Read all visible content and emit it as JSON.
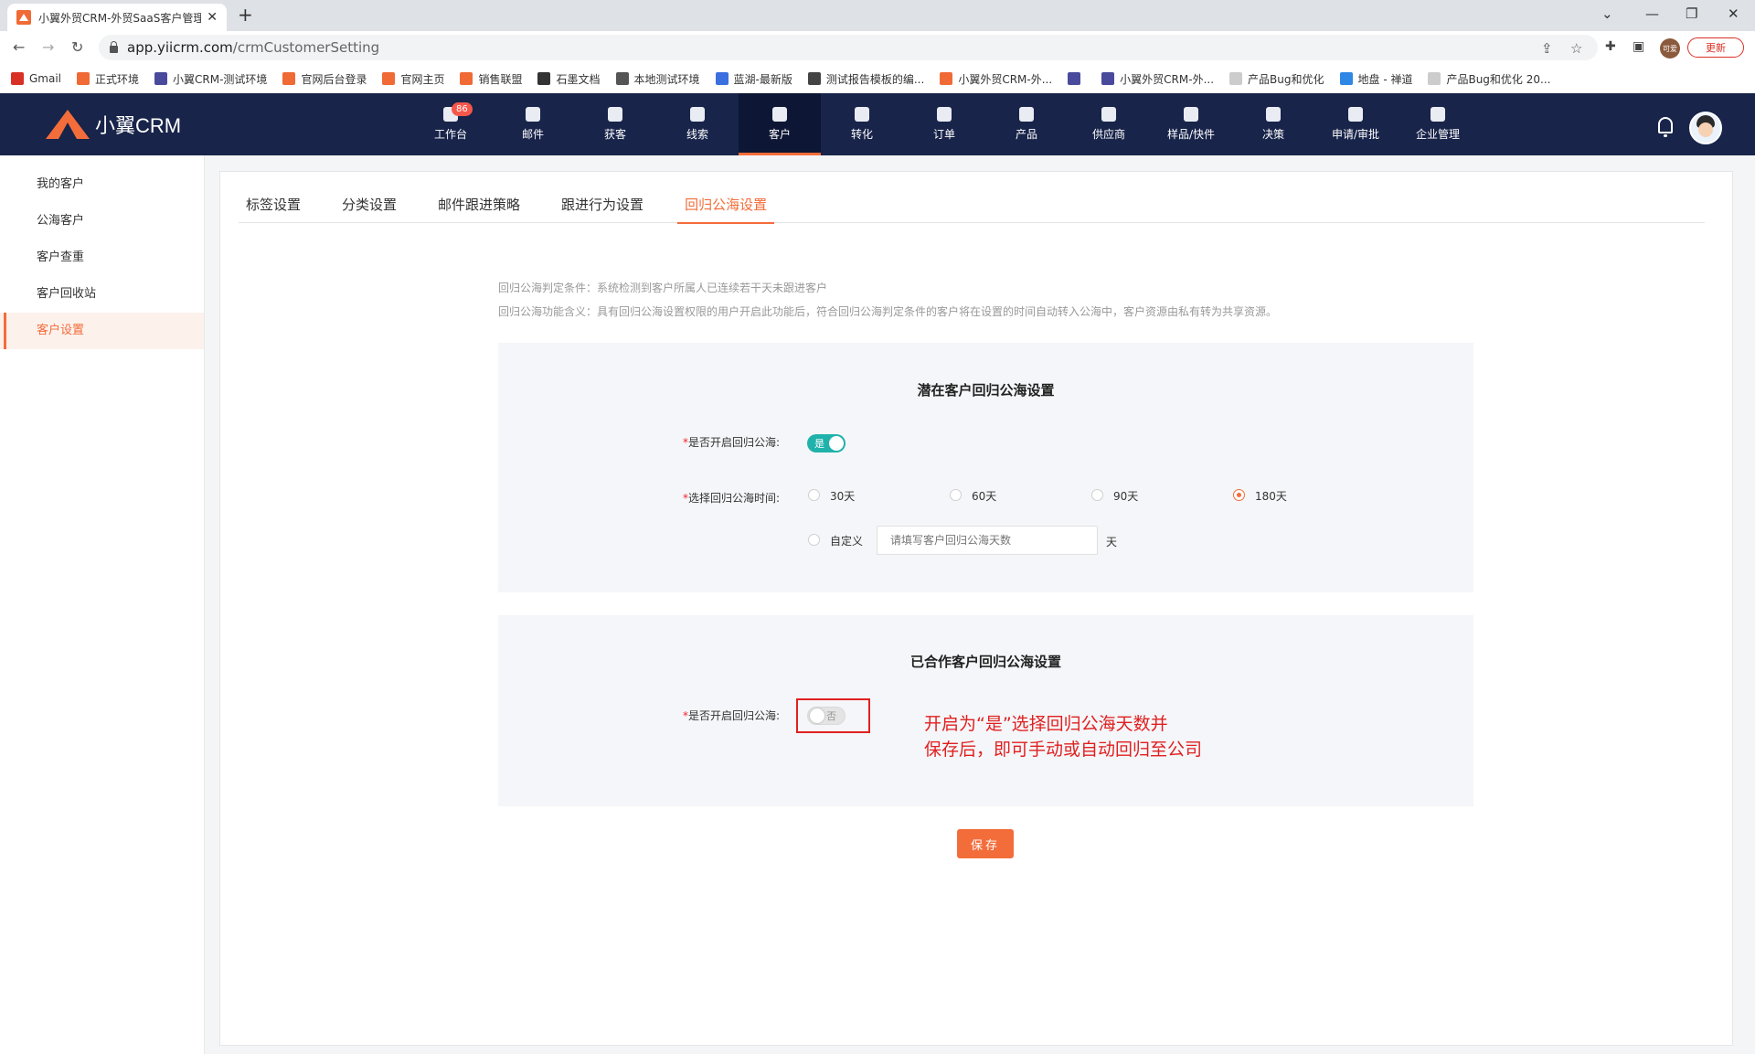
{
  "browser": {
    "tab_title": "小翼外贸CRM-外贸SaaS客户管理",
    "url_host": "app.yiicrm.com",
    "url_path": "/crmCustomerSetting",
    "update_label": "更新",
    "profile_label": "可爱"
  },
  "bookmarks": [
    {
      "label": "Gmail",
      "color": "#d93025"
    },
    {
      "label": "正式环境",
      "color": "#f06a35"
    },
    {
      "label": "小翼CRM-测试环境",
      "color": "#4a4a9c"
    },
    {
      "label": "官网后台登录",
      "color": "#f06a35"
    },
    {
      "label": "官网主页",
      "color": "#f06a35"
    },
    {
      "label": "销售联盟",
      "color": "#f06a35"
    },
    {
      "label": "石墨文档",
      "color": "#333333"
    },
    {
      "label": "本地测试环境",
      "color": "#555555"
    },
    {
      "label": "蓝湖-最新版",
      "color": "#3b6fe0"
    },
    {
      "label": "测试报告模板的编...",
      "color": "#444444"
    },
    {
      "label": "小翼外贸CRM-外...",
      "color": "#f06a35"
    },
    {
      "label": "",
      "color": "#4a4a9c"
    },
    {
      "label": "小翼外贸CRM-外...",
      "color": "#4a4a9c"
    },
    {
      "label": "产品Bug和优化",
      "color": "#cccccc"
    },
    {
      "label": "地盘 - 禅道",
      "color": "#2e87e5"
    },
    {
      "label": "产品Bug和优化 20...",
      "color": "#cccccc"
    }
  ],
  "app": {
    "logo_text": "小翼CRM",
    "nav": [
      {
        "label": "工作台",
        "badge": "86"
      },
      {
        "label": "邮件"
      },
      {
        "label": "获客"
      },
      {
        "label": "线索"
      },
      {
        "label": "客户",
        "active": true
      },
      {
        "label": "转化"
      },
      {
        "label": "订单"
      },
      {
        "label": "产品"
      },
      {
        "label": "供应商"
      },
      {
        "label": "样品/快件"
      },
      {
        "label": "决策"
      },
      {
        "label": "申请/审批"
      },
      {
        "label": "企业管理"
      }
    ],
    "accent": "#f36d3b",
    "header_bg": "#18244a"
  },
  "sidebar": {
    "items": [
      {
        "label": "我的客户"
      },
      {
        "label": "公海客户"
      },
      {
        "label": "客户查重"
      },
      {
        "label": "客户回收站"
      },
      {
        "label": "客户设置",
        "active": true
      }
    ]
  },
  "tabs": [
    "标签设置",
    "分类设置",
    "邮件跟进策略",
    "跟进行为设置",
    "回归公海设置"
  ],
  "active_tab": "回归公海设置",
  "description": {
    "line1": "回归公海判定条件：系统检测到客户所属人已连续若干天未跟进客户",
    "line2": "回归公海功能含义：具有回归公海设置权限的用户开启此功能后，符合回归公海判定条件的客户将在设置的时间自动转入公海中，客户资源由私有转为共享资源。"
  },
  "potential": {
    "title": "潜在客户回归公海设置",
    "enable_label": "是否开启回归公海:",
    "enable_value": "是",
    "time_label": "选择回归公海时间:",
    "options": [
      "30天",
      "60天",
      "90天",
      "180天"
    ],
    "selected": "180天",
    "custom_label": "自定义",
    "custom_placeholder": "请填写客户回归公海天数",
    "unit": "天"
  },
  "cooperated": {
    "title": "已合作客户回归公海设置",
    "enable_label": "是否开启回归公海:",
    "enable_value": "否"
  },
  "annotation": {
    "line1": "开启为“是”选择回归公海天数并",
    "line2": "保存后，即可手动或自动回归至公司"
  },
  "save_label": "保存",
  "required_mark": "*"
}
